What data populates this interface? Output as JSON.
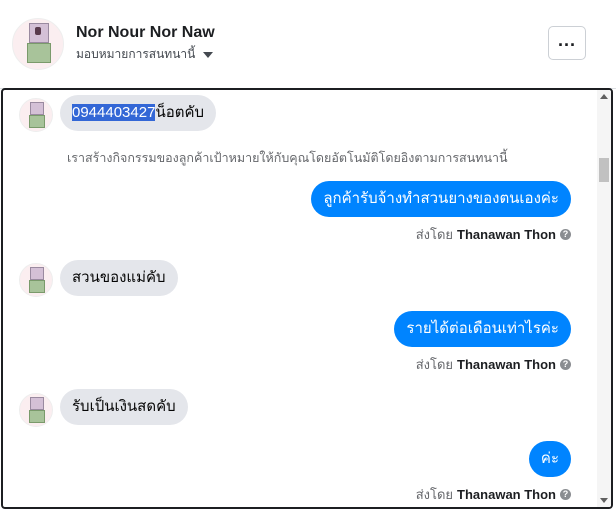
{
  "header": {
    "name": "Nor Nour Nor Naw",
    "assign_label": "มอบหมายการสนทนานี้",
    "more_label": "..."
  },
  "messages": {
    "m1_selected": "0944403427",
    "m1_rest": "น็อตคับ",
    "notice": "เราสร้างกิจกรรมของลูกค้าเป้าหมายให้กับคุณโดยอัตโนมัติโดยอิงตามการสนทนานี้",
    "m2": "ลูกค้ารับจ้างทำสวนยางของตนเองค่ะ",
    "m3": "สวนของแม่คับ",
    "m4": "รายได้ต่อเดือนเท่าไรค่ะ",
    "m5": "รับเป็นเงินสดคับ",
    "m6": "ค่ะ"
  },
  "sent_by": {
    "prefix": "ส่งโดย",
    "agent": "Thanawan Thon",
    "help": "?"
  }
}
